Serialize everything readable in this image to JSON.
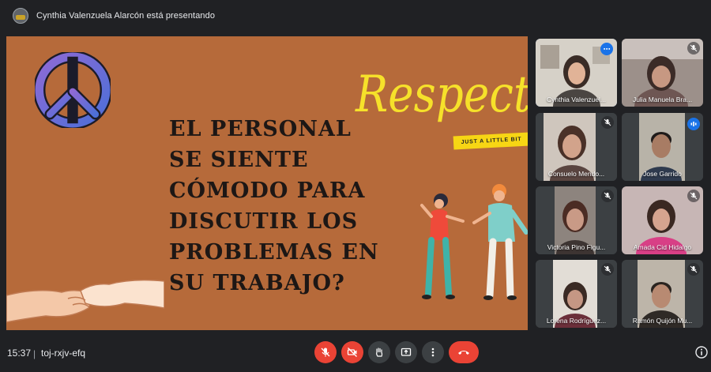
{
  "header": {
    "presenting_text": "Cynthia Valenzuela Alarcón está presentando"
  },
  "slide": {
    "question_lines": [
      "EL PERSONAL",
      "SE SIENTE",
      "CÓMODO PARA",
      "DISCUTIR LOS",
      "PROBLEMAS EN",
      "SU TRABAJO?"
    ],
    "headline": "Respect",
    "tagline": "JUST A LITTLE BIT",
    "colors": {
      "background": "#b66a3a",
      "headline": "#f6e12a",
      "tag": "#f7d614",
      "text": "#1d1715"
    }
  },
  "participants": [
    {
      "name": "Cynthia Valenzuel...",
      "status": "more-options",
      "active": true
    },
    {
      "name": "Julia Manuela Bra...",
      "status": "muted",
      "active": false
    },
    {
      "name": "Consuelo Mendo...",
      "status": "muted",
      "active": false
    },
    {
      "name": "Jose Garrido",
      "status": "speaking",
      "active": false
    },
    {
      "name": "Victoria Pino Figu...",
      "status": "muted",
      "active": false
    },
    {
      "name": "Amada Cid Hidalgo",
      "status": "muted",
      "active": false
    },
    {
      "name": "Lorena Rodríguez...",
      "status": "muted",
      "active": false
    },
    {
      "name": "Ramón Quijón Mu...",
      "status": "muted",
      "active": false
    }
  ],
  "footer": {
    "time": "15:37",
    "separator": "|",
    "meeting_code": "toj-rxjv-efq"
  },
  "controls": [
    {
      "name": "microphone-off-button",
      "icon": "mic-off-icon"
    },
    {
      "name": "camera-off-button",
      "icon": "video-off-icon"
    },
    {
      "name": "raise-hand-button",
      "icon": "hand-icon"
    },
    {
      "name": "present-now-button",
      "icon": "present-icon"
    },
    {
      "name": "more-options-button",
      "icon": "more-vert-icon"
    },
    {
      "name": "leave-call-button",
      "icon": "phone-hangup-icon"
    }
  ],
  "colors": {
    "app_bg": "#202124",
    "tile_bg": "#3c4043",
    "accent": "#1a73e8",
    "danger": "#ea4335"
  }
}
